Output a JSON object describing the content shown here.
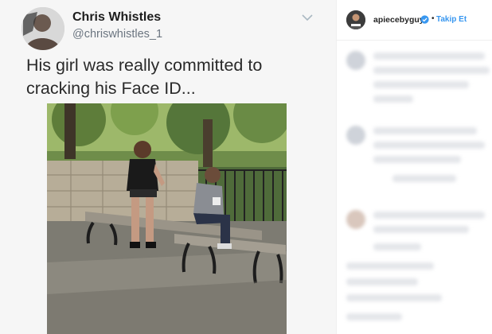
{
  "tweet": {
    "display_name": "Chris Whistles",
    "handle": "@chriswhistles_1",
    "text": "His girl was really committed to cracking his Face ID...",
    "menu_icon": "chevron-down-icon"
  },
  "instagram": {
    "username": "apiecebyguy",
    "separator": "•",
    "follow_label": "Takip Et",
    "verified_icon": "verified-badge-icon",
    "accent_color": "#3897f0"
  }
}
